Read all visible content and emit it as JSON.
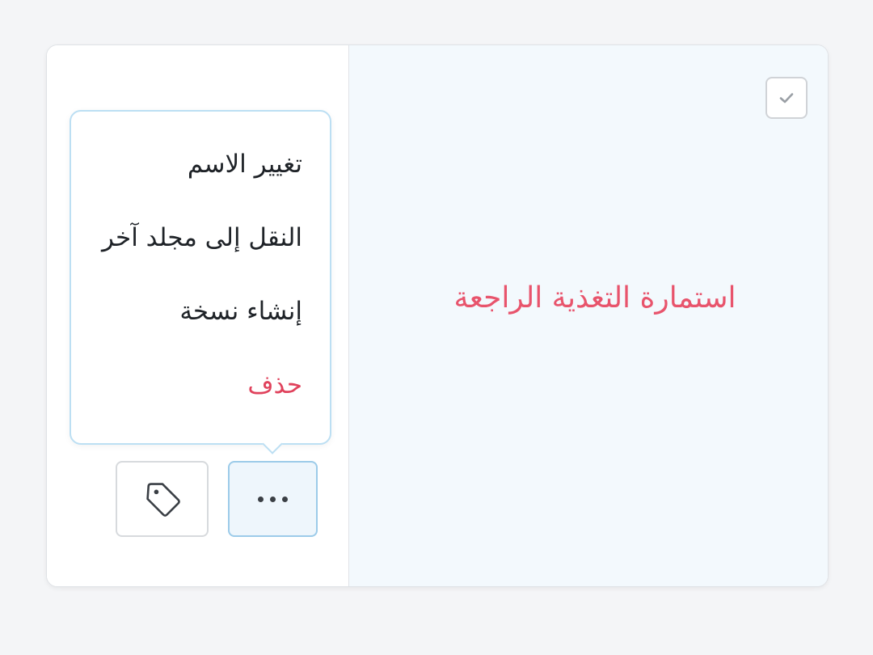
{
  "card": {
    "form_title": "استمارة التغذية الراجعة"
  },
  "menu": {
    "items": [
      {
        "label": "تغيير الاسم"
      },
      {
        "label": "النقل إلى مجلد آخر"
      },
      {
        "label": "إنشاء نسخة"
      },
      {
        "label": "حذف"
      }
    ]
  },
  "icons": {
    "checkbox": "check-icon",
    "tag": "tag-icon",
    "more": "more-horizontal-icon"
  },
  "colors": {
    "title": "#e8546c",
    "danger": "#e0425c",
    "accent_border": "#9ccbe9",
    "preview_bg": "#f3f9fd"
  }
}
